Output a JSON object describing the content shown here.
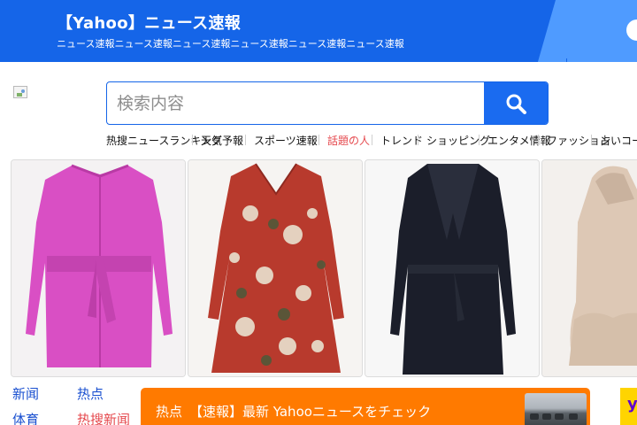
{
  "banner": {
    "title": "【Yahoo】ニュース速報",
    "subtitle": "ニュース速報ニュース速報ニュース速報ニュース速報ニュース速報ニュース速報",
    "colors": {
      "primary": "#1565e8",
      "secondary": "#4f9bff"
    }
  },
  "logo": {
    "alt": "Yahoo"
  },
  "search": {
    "placeholder": "検索内容",
    "value": "",
    "button_icon": "search-icon"
  },
  "quick_links": {
    "lead_prefix": "热搜",
    "lead": "ニュースランキング",
    "items": [
      {
        "label": "天気予報",
        "hot": false
      },
      {
        "label": "スポーツ速報",
        "hot": false
      },
      {
        "label": "話題の人",
        "hot": true
      },
      {
        "label": "トレンド",
        "hot": false
      },
      {
        "label": "ショッピング",
        "hot": false
      },
      {
        "label": "エンタメ情報",
        "hot": false
      },
      {
        "label": "ファッション",
        "hot": false
      },
      {
        "label": "占いコーナー",
        "hot": false
      }
    ]
  },
  "products": [
    {
      "name": "pink-wool-coat",
      "color": "#d94fc4"
    },
    {
      "name": "red-floral-dress",
      "color": "#b83a2d"
    },
    {
      "name": "black-wrap-coat",
      "color": "#1b1e2a"
    },
    {
      "name": "beige-hooded-dress",
      "color": "#ddc8b5"
    }
  ],
  "side_links": {
    "col1": [
      "新闻",
      "体育"
    ],
    "col2": [
      "热点",
      "热搜新闻"
    ],
    "red_index_col2": 1
  },
  "news": {
    "tag": "热点",
    "text": "【速報】最新 Yahooニュースをチェック",
    "accent": "#ff7a00"
  },
  "yahoo_badge": {
    "letter": "y",
    "color": "#ffd400"
  }
}
